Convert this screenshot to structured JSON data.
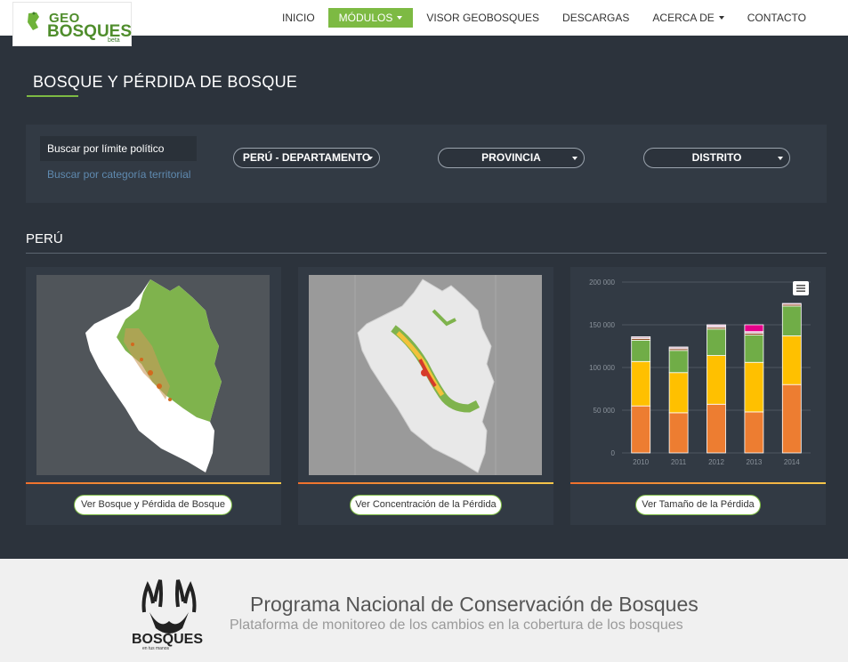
{
  "navbar": {
    "logo": {
      "geo": "GEO",
      "bosques": "BOSQUES",
      "beta": "beta"
    },
    "items": [
      {
        "label": "INICIO",
        "active": false,
        "dropdown": false
      },
      {
        "label": "MÓDULOS",
        "active": true,
        "dropdown": true
      },
      {
        "label": "VISOR GEOBOSQUES",
        "active": false,
        "dropdown": false
      },
      {
        "label": "DESCARGAS",
        "active": false,
        "dropdown": false
      },
      {
        "label": "ACERCA DE",
        "active": false,
        "dropdown": true
      },
      {
        "label": "CONTACTO",
        "active": false,
        "dropdown": false
      }
    ]
  },
  "page": {
    "title": "BOSQUE Y PÉRDIDA DE BOSQUE"
  },
  "filters": {
    "tabs": [
      {
        "label": "Buscar por límite político",
        "active": true
      },
      {
        "label": "Buscar por categoría territorial",
        "active": false
      }
    ],
    "selects": [
      {
        "label": "PERÚ - DEPARTAMENTO"
      },
      {
        "label": "PROVINCIA"
      },
      {
        "label": "DISTRITO"
      }
    ]
  },
  "section": {
    "heading": "PERÚ"
  },
  "cards": [
    {
      "button": "Ver Bosque y Pérdida de Bosque",
      "image": "peru-forest-map"
    },
    {
      "button": "Ver Concentración de la Pérdida",
      "image": "peru-loss-concentration-map"
    },
    {
      "button": "Ver Tamaño de la Pérdida",
      "image": "loss-size-chart"
    }
  ],
  "chart_data": {
    "type": "bar",
    "stacked": true,
    "categories": [
      "2010",
      "2011",
      "2012",
      "2013",
      "2014"
    ],
    "series": [
      {
        "color": "#ed7d31",
        "values": [
          55000,
          47000,
          57000,
          48000,
          80000
        ]
      },
      {
        "color": "#ffc000",
        "values": [
          52000,
          47000,
          57000,
          58000,
          57000
        ]
      },
      {
        "color": "#70ad47",
        "values": [
          25000,
          26000,
          31000,
          32000,
          35000
        ]
      },
      {
        "color": "#843c0c",
        "values": [
          2000,
          2000,
          2000,
          2000,
          2000
        ]
      },
      {
        "color": "#d6b4c8",
        "values": [
          2000,
          2000,
          2000,
          2000,
          0
        ]
      },
      {
        "color": "#e6008a",
        "values": [
          0,
          0,
          1000,
          8000,
          1000
        ]
      }
    ],
    "ylim": [
      0,
      200000
    ],
    "yticks": [
      "0",
      "50 000",
      "100 000",
      "150 000",
      "200 000"
    ],
    "grid": true,
    "menu_icon": "hamburger-menu-icon"
  },
  "footer": {
    "logo_text": "BOSQUES",
    "logo_sub": "en tus manos",
    "title": "Programa Nacional de Conservación de Bosques",
    "subtitle": "Plataforma de monitoreo de los cambios en la cobertura de los bosques"
  },
  "colors": {
    "accent": "#7dba43",
    "background": "#2c333c",
    "panel": "#323a44"
  }
}
